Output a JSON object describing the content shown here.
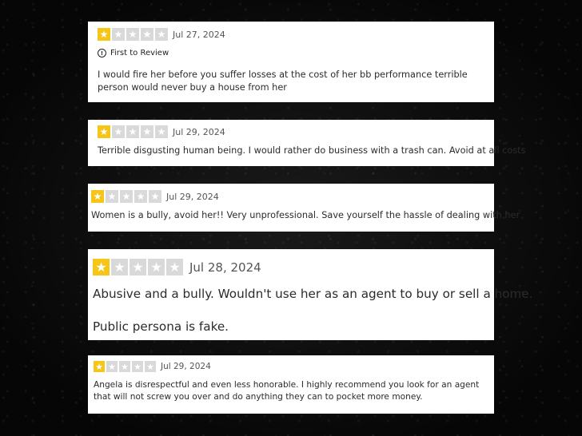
{
  "colors": {
    "star_filled": "#f5c518",
    "star_empty": "#d9d9d9",
    "background": "#0d0d0d"
  },
  "reviews": [
    {
      "rating": 1,
      "max_rating": 5,
      "date": "Jul 27, 2024",
      "badge": "First to Review",
      "text": "I would fire her before you suffer losses at the cost of her bb performance terrible person would never buy a house from her"
    },
    {
      "rating": 1,
      "max_rating": 5,
      "date": "Jul 29, 2024",
      "text": "Terrible disgusting human being. I would rather do business with a trash can. Avoid at all costs"
    },
    {
      "rating": 1,
      "max_rating": 5,
      "date": "Jul 29, 2024",
      "text": "Women is a bully, avoid her!! Very unprofessional. Save yourself the hassle of dealing with her"
    },
    {
      "rating": 1,
      "max_rating": 5,
      "date": "Jul 28, 2024",
      "text": "Abusive and a bully. Wouldn't use her as an agent to buy or sell a home.",
      "text2": "Public persona is fake."
    },
    {
      "rating": 1,
      "max_rating": 5,
      "date": "Jul 29, 2024",
      "text": "Angela is disrespectful and even less honorable. I highly recommend you look for an agent that will not screw you over and do anything they can to pocket more money."
    }
  ]
}
